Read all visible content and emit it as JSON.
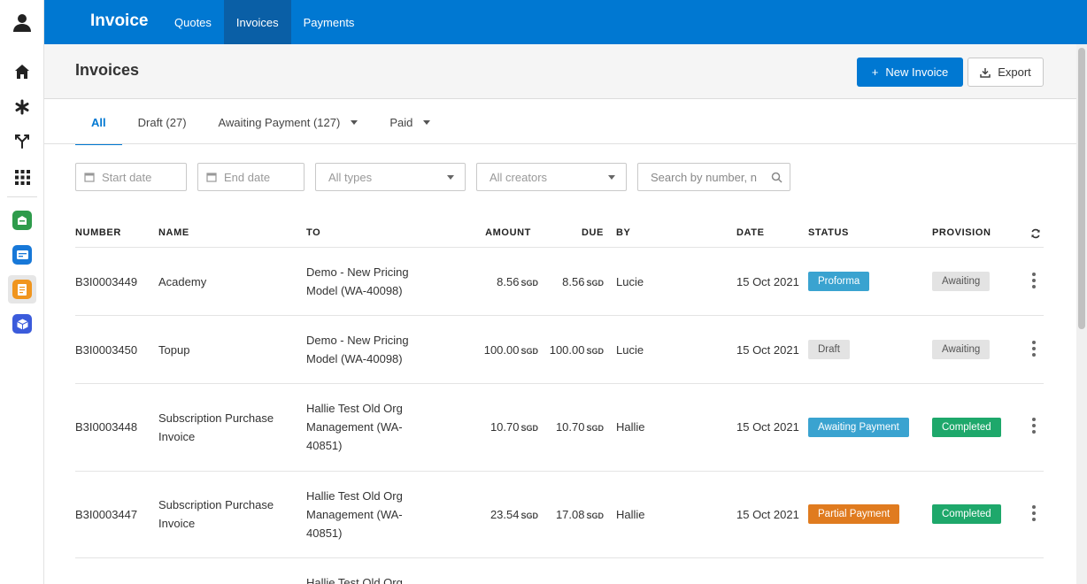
{
  "topbar": {
    "brand": "Invoice",
    "nav": [
      {
        "label": "Quotes"
      },
      {
        "label": "Invoices"
      },
      {
        "label": "Payments"
      }
    ]
  },
  "page": {
    "title": "Invoices",
    "new_button": "New Invoice",
    "new_icon": "+",
    "export_button": "Export"
  },
  "tabs": [
    {
      "label": "All"
    },
    {
      "label": "Draft (27)"
    },
    {
      "label": "Awaiting Payment (127)"
    },
    {
      "label": "Paid"
    }
  ],
  "filters": {
    "start_date": "Start date",
    "end_date": "End date",
    "types": "All types",
    "creators": "All creators",
    "search_placeholder": "Search by number, n"
  },
  "table": {
    "headers": {
      "number": "NUMBER",
      "name": "NAME",
      "to": "TO",
      "amount": "AMOUNT",
      "due": "DUE",
      "by": "BY",
      "date": "DATE",
      "status": "STATUS",
      "provision": "PROVISION"
    },
    "currency": "SGD",
    "rows": [
      {
        "number": "B3I0003449",
        "name": [
          "Academy"
        ],
        "to": [
          "Demo - New Pricing",
          "Model (WA-40098)"
        ],
        "amount": "8.56",
        "due": "8.56",
        "by": "Lucie",
        "date": "15 Oct 2021",
        "status": "Proforma",
        "provision": "Awaiting"
      },
      {
        "number": "B3I0003450",
        "name": [
          "Topup"
        ],
        "to": [
          "Demo - New Pricing",
          "Model (WA-40098)"
        ],
        "amount": "100.00",
        "due": "100.00",
        "by": "Lucie",
        "date": "15 Oct 2021",
        "status": "Draft",
        "provision": "Awaiting"
      },
      {
        "number": "B3I0003448",
        "name": [
          "Subscription Purchase",
          "Invoice"
        ],
        "to": [
          "Hallie Test Old Org",
          "Management (WA-",
          "40851)"
        ],
        "amount": "10.70",
        "due": "10.70",
        "by": "Hallie",
        "date": "15 Oct 2021",
        "status": "Awaiting Payment",
        "provision": "Completed"
      },
      {
        "number": "B3I0003447",
        "name": [
          "Subscription Purchase",
          "Invoice"
        ],
        "to": [
          "Hallie Test Old Org",
          "Management (WA-",
          "40851)"
        ],
        "amount": "23.54",
        "due": "17.08",
        "by": "Hallie",
        "date": "15 Oct 2021",
        "status": "Partial Payment",
        "provision": "Completed"
      },
      {
        "to": [
          "Hallie Test Old Org"
        ]
      }
    ]
  },
  "colors": {
    "primary": "#0078d2",
    "proforma": "#3aa3d0",
    "partial": "#e07b1f",
    "completed": "#1ea86b"
  }
}
